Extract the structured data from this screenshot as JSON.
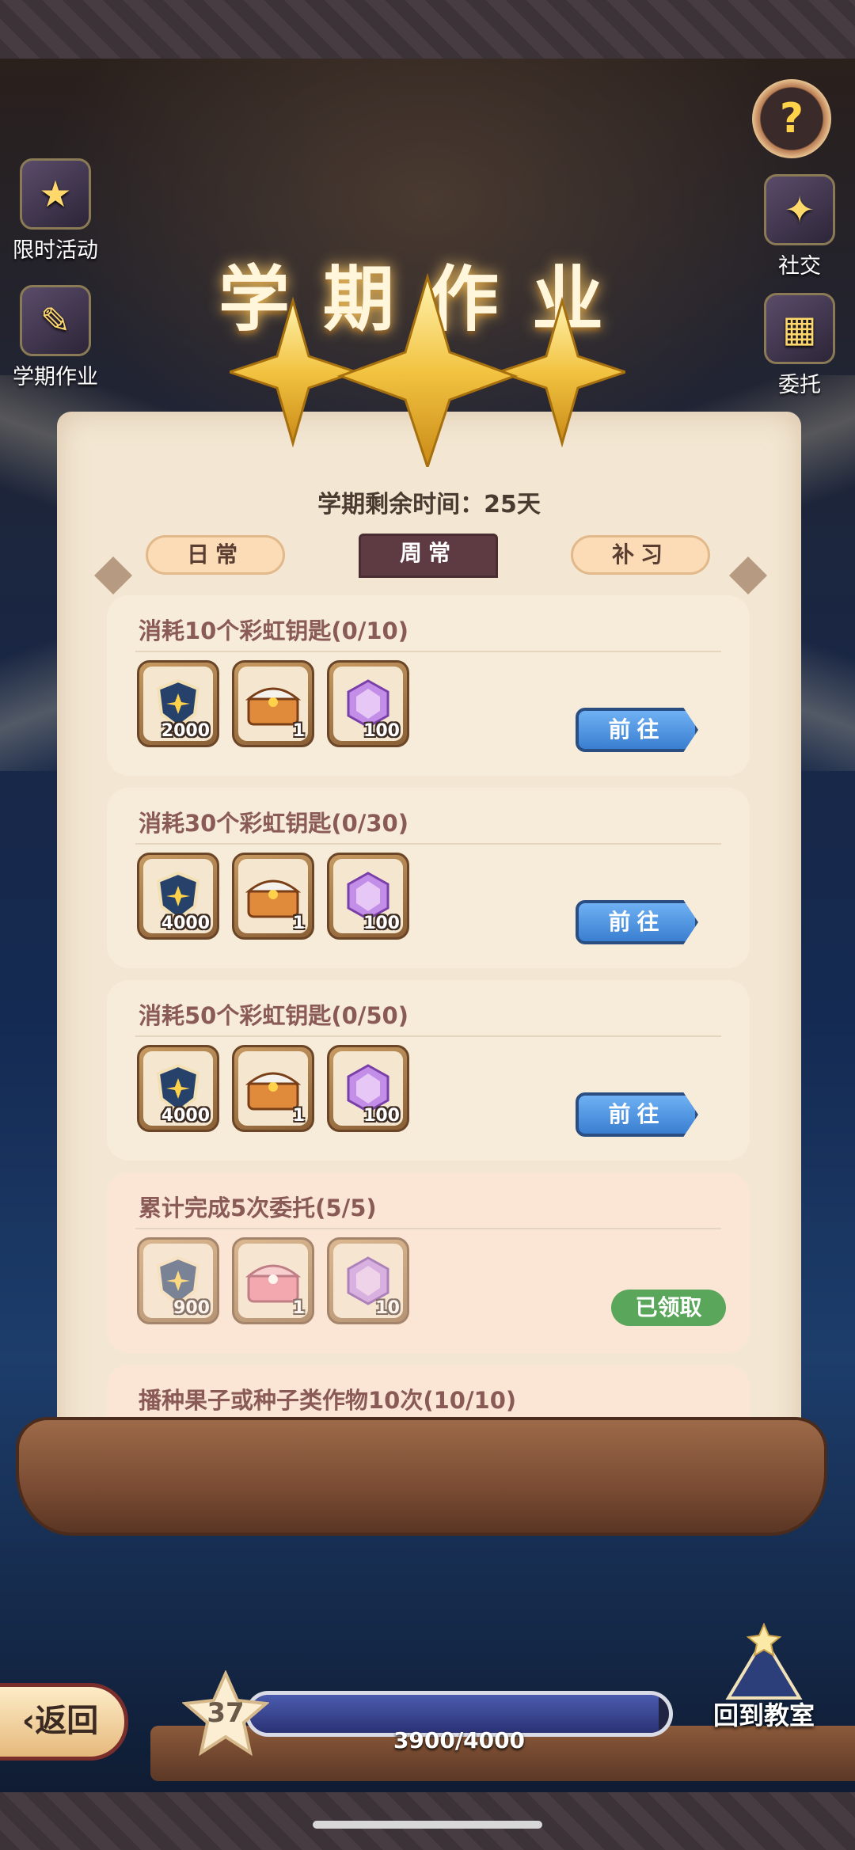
{
  "header": {
    "title": "学期作业",
    "time_remaining": "学期剩余时间：25天"
  },
  "side_left": [
    {
      "label": "限时活动",
      "icon": "event-icon"
    },
    {
      "label": "学期作业",
      "icon": "homework-icon"
    }
  ],
  "side_right": [
    {
      "label": "社交",
      "icon": "social-icon"
    },
    {
      "label": "委托",
      "icon": "commission-icon"
    }
  ],
  "tabs": [
    {
      "label": "日常",
      "active": false
    },
    {
      "label": "周常",
      "active": true
    },
    {
      "label": "补习",
      "active": false
    }
  ],
  "tasks": [
    {
      "title": "消耗10个彩虹钥匙(0/10)",
      "rewards": [
        {
          "icon": "shield-star-icon",
          "count": "2000"
        },
        {
          "icon": "treasure-chest-icon",
          "count": "1"
        },
        {
          "icon": "purple-gem-icon",
          "count": "100"
        }
      ],
      "action": "前往",
      "claimed": false
    },
    {
      "title": "消耗30个彩虹钥匙(0/30)",
      "rewards": [
        {
          "icon": "shield-star-icon",
          "count": "4000"
        },
        {
          "icon": "treasure-chest-icon",
          "count": "1"
        },
        {
          "icon": "purple-gem-icon",
          "count": "100"
        }
      ],
      "action": "前往",
      "claimed": false
    },
    {
      "title": "消耗50个彩虹钥匙(0/50)",
      "rewards": [
        {
          "icon": "shield-star-icon",
          "count": "4000"
        },
        {
          "icon": "treasure-chest-icon",
          "count": "1"
        },
        {
          "icon": "purple-gem-icon",
          "count": "100"
        }
      ],
      "action": "前往",
      "claimed": false
    },
    {
      "title": "累计完成5次委托(5/5)",
      "rewards": [
        {
          "icon": "shield-star-icon",
          "count": "900"
        },
        {
          "icon": "pink-chest-icon",
          "count": "1"
        },
        {
          "icon": "purple-gem-icon",
          "count": "10"
        }
      ],
      "action": "已领取",
      "claimed": true
    },
    {
      "title": "播种果子或种子类作物10次(10/10)",
      "rewards": [
        {
          "icon": "shield-star-icon",
          "count": ""
        },
        {
          "icon": "pink-chest-icon",
          "count": ""
        },
        {
          "icon": "purple-gem-icon",
          "count": ""
        }
      ],
      "action": "",
      "claimed": true
    }
  ],
  "footer": {
    "back_label": "返回",
    "level": "37",
    "xp_text": "3900/4000",
    "xp_fraction": 0.975,
    "classroom_label": "回到教室"
  },
  "colors": {
    "accent_blue": "#3a7ed1",
    "claimed_green": "#5aa65b",
    "task_title": "#8a5a56",
    "active_tab": "#5e3a43"
  }
}
